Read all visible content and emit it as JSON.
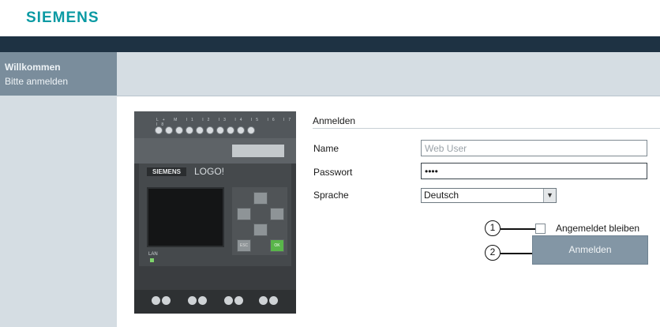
{
  "header": {
    "logo_text": "SIEMENS"
  },
  "welcome": {
    "title": "Willkommen",
    "subtitle": "Bitte anmelden"
  },
  "device": {
    "brand": "SIEMENS",
    "model": "LOGO!",
    "lan_label": "LAN",
    "terminal_labels": "L+ M I1 I2 I3 I4 I5 I6 I7 I8",
    "key_esc": "ESC",
    "key_ok": "OK"
  },
  "form": {
    "heading": "Anmelden",
    "name_label": "Name",
    "name_placeholder": "Web User",
    "password_label": "Passwort",
    "password_value": "••••",
    "language_label": "Sprache",
    "language_selected": "Deutsch",
    "remember_label": "Angemeldet bleiben",
    "remember_checked": false,
    "submit_label": "Anmelden"
  },
  "callouts": {
    "one": "1",
    "two": "2"
  },
  "icons": {
    "dropdown": "chevron-down-icon"
  },
  "colors": {
    "brand": "#0a9aa3",
    "topbar": "#1e3243",
    "button": "#8396a5"
  }
}
